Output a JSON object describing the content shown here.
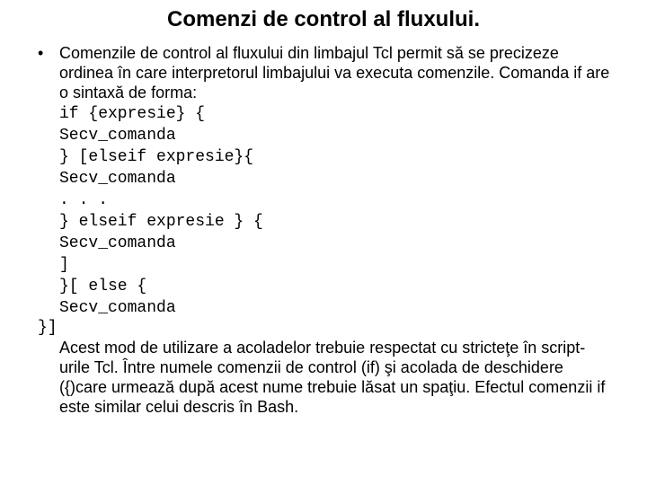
{
  "title": "Comenzi de control al fluxului.",
  "bullet_marker": "•",
  "intro": "Comenzile de control al fluxului din limbajul Tcl permit să se precizeze ordinea în care interpretorul limbajului va executa comenzile. Comanda if are o sintaxă de forma:",
  "code1": "if {expresie} {",
  "code2": "Secv_comanda",
  "code3": "} [elseif expresie}{",
  "code4": "Secv_comanda",
  "code5": ". . .",
  "code6": "} elseif expresie } {",
  "code7": "Secv_comanda",
  "code8": "]",
  "code9": "}[ else {",
  "code10": "Secv_comanda",
  "code11": "}]",
  "outro": "Acest mod de utilizare a acoladelor trebuie respectat cu stricteţe în script-urile Tcl. Între numele comenzii de control (if) şi acolada de deschidere ({)care urmează după acest nume trebuie lăsat un spaţiu. Efectul comenzii if este similar celui descris în Bash."
}
